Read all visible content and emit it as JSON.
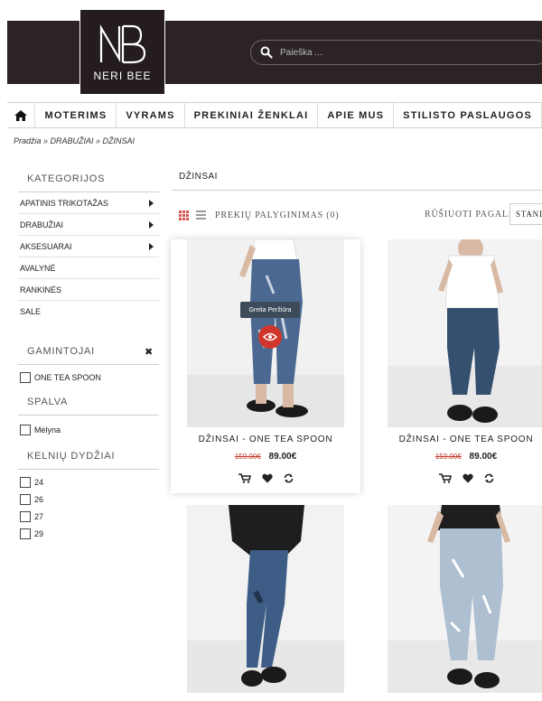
{
  "header": {
    "logo_monogram": "NB",
    "logo_text": "NERI BEE",
    "search_placeholder": "Paieška ..."
  },
  "nav": {
    "items": [
      "MOTERIMS",
      "VYRAMS",
      "PREKINIAI ŽENKLAI",
      "APIE MUS",
      "STILISTO PASLAUGOS"
    ]
  },
  "breadcrumb": "Pradžia » DRABUŽIAI » DŽINSAI",
  "sidebar": {
    "categories_title": "KATEGORIJOS",
    "categories": [
      {
        "label": "APATINIS TRIKOTAŽAS",
        "has_children": true
      },
      {
        "label": "DRABUŽIAI",
        "has_children": true
      },
      {
        "label": "AKSESUARAI",
        "has_children": true
      },
      {
        "label": "AVALYNĖ",
        "has_children": false
      },
      {
        "label": "RANKINĖS",
        "has_children": false
      },
      {
        "label": "SALE",
        "has_children": false
      }
    ],
    "manufacturers_title": "GAMINTOJAI",
    "manufacturers": [
      "ONE TEA SPOON"
    ],
    "color_title": "SPALVA",
    "colors": [
      "Mėlyna"
    ],
    "sizes_title": "KELNIŲ DYDŽIAI",
    "sizes": [
      "24",
      "26",
      "27",
      "29"
    ]
  },
  "main": {
    "title": "DŽINSAI",
    "compare_label": "PREKIŲ PALYGINIMAS (0)",
    "sort_label": "RŪŠIUOTI PAGAL:",
    "sort_value": "STAND"
  },
  "products": [
    {
      "name": "DŽINSAI - ONE TEA SPOON",
      "old_price": "159.00€",
      "new_price": "89.00€",
      "quick_view": "Greita Peržiūra"
    },
    {
      "name": "DŽINSAI - ONE TEA SPOON",
      "old_price": "159.00€",
      "new_price": "89.00€"
    },
    {
      "name": "",
      "old_price": "",
      "new_price": ""
    },
    {
      "name": "",
      "old_price": "",
      "new_price": ""
    }
  ],
  "colors": {
    "header_bg": "#2b2324",
    "accent": "#d0362c",
    "old_price": "#c0392b"
  }
}
